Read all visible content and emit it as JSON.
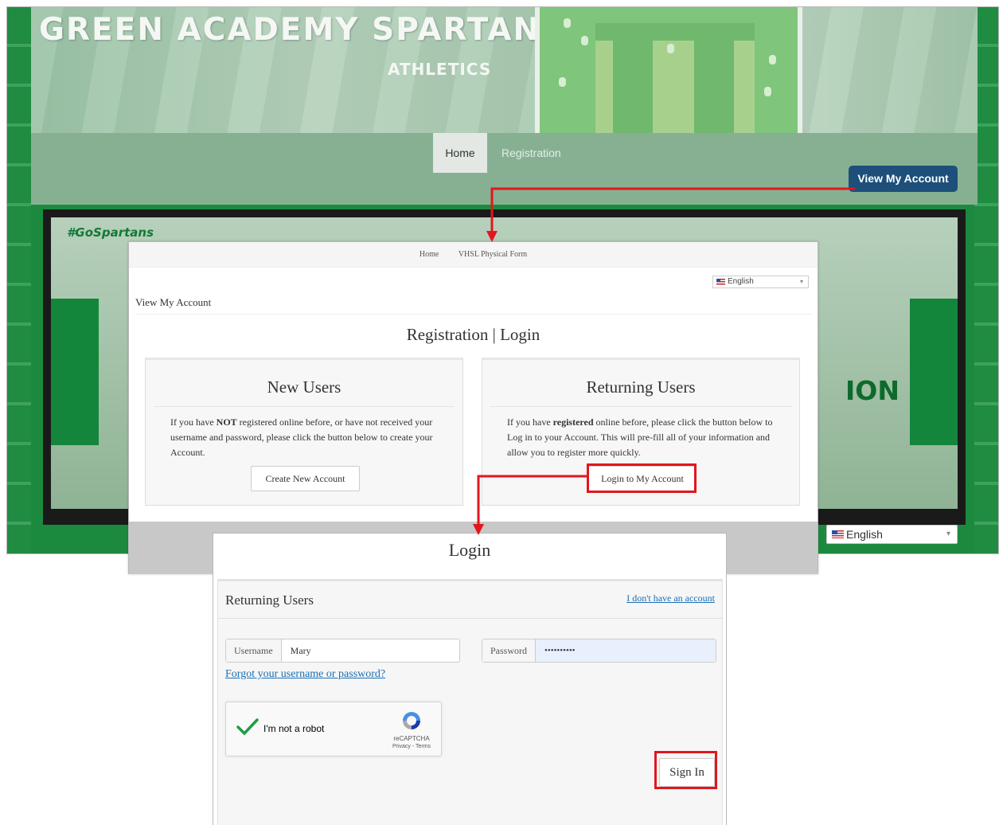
{
  "site": {
    "banner_title": "GREEN ACADEMY SPARTANS",
    "banner_subtitle": "ATHLETICS",
    "nav": {
      "home": "Home",
      "registration": "Registration"
    },
    "view_account_button": "View My Account",
    "hero_hashtag": "#GoSpartans",
    "hero_fragment": "ION",
    "language": "English"
  },
  "registration": {
    "topnav": {
      "home": "Home",
      "physical_form": "VHSL Physical Form"
    },
    "language": "English",
    "breadcrumb": "View My Account",
    "heading": "Registration | Login",
    "new_users": {
      "title": "New Users",
      "text_before": "If you have ",
      "text_bold": "NOT",
      "text_after": " registered online before, or have not received your username and password, please click the button below to create your Account.",
      "button": "Create New Account"
    },
    "returning_users": {
      "title": "Returning Users",
      "text_before": "If you have ",
      "text_bold": "registered",
      "text_after": " online before, please click the button below to Log in to your Account. This will pre-fill all of your information and allow you to register more quickly.",
      "button": "Login to My Account"
    }
  },
  "login": {
    "title": "Login",
    "panel_heading": "Returning Users",
    "no_account_link": "I don't have an account",
    "username_label": "Username",
    "username_value": "Mary",
    "password_label": "Password",
    "password_value": "••••••••••",
    "forgot_link": "Forgot your username or password?",
    "recaptcha": {
      "label": "I'm not a robot",
      "brand": "reCAPTCHA",
      "terms": "Privacy - Terms"
    },
    "sign_in_button": "Sign In"
  },
  "annotation": {
    "highlight_color": "#e3161d"
  }
}
